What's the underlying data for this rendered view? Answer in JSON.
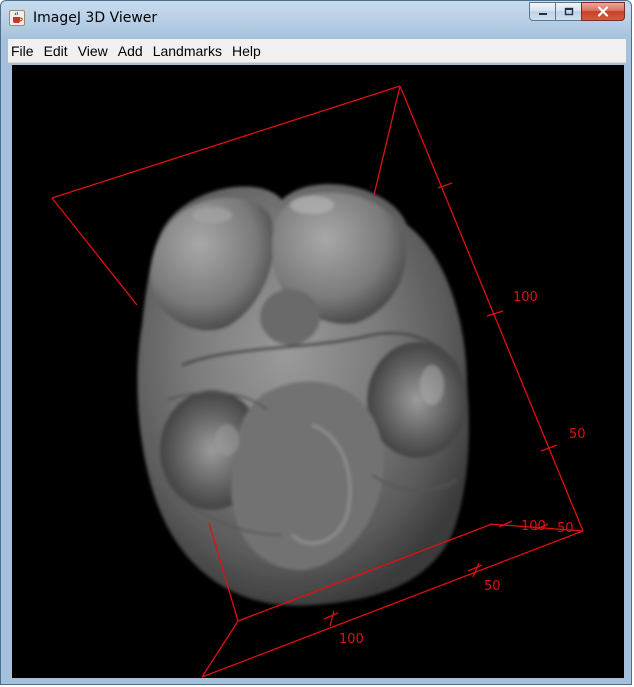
{
  "window": {
    "title": "ImageJ 3D Viewer",
    "app_icon": "java-coffee-cup-icon"
  },
  "window_controls": {
    "minimize_icon": "minimize-icon",
    "maximize_icon": "maximize-icon",
    "close_icon": "close-icon"
  },
  "menubar": {
    "items": [
      "File",
      "Edit",
      "View",
      "Add",
      "Landmarks",
      "Help"
    ]
  },
  "viewer": {
    "background": "#000000",
    "bounding_box_color": "#e01010",
    "axis_labels": [
      "100",
      "50",
      "100",
      "50",
      "50",
      "100"
    ]
  }
}
